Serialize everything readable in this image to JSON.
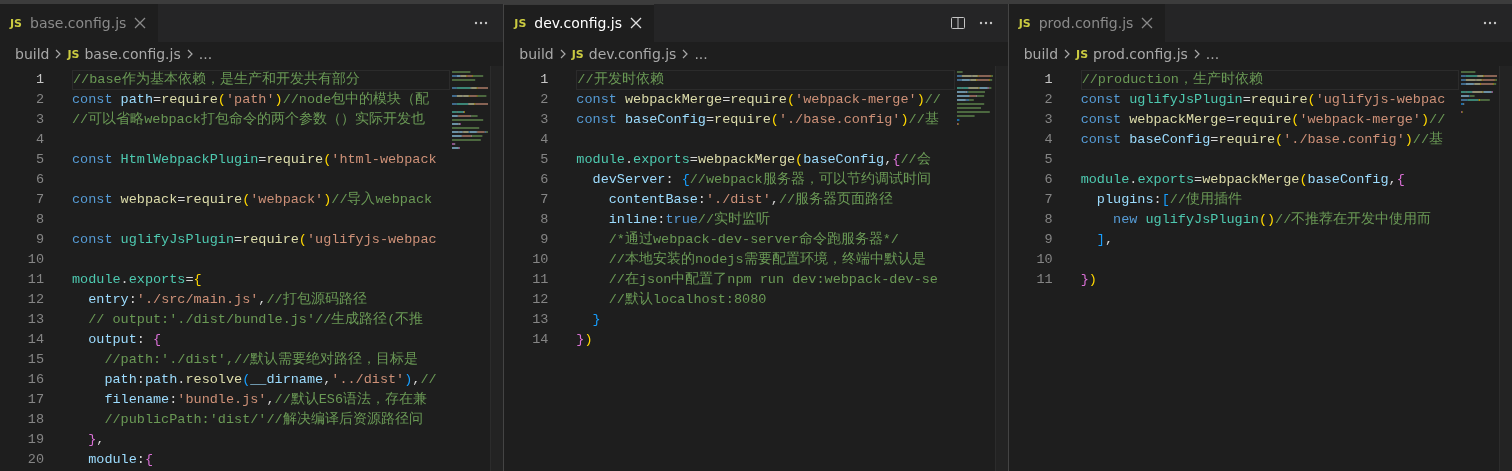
{
  "panes": [
    {
      "focused": false,
      "show_split": false,
      "tab": {
        "icon_text": "JS",
        "label": "base.config.js"
      },
      "breadcrumb": {
        "folder": "build",
        "icon_text": "JS",
        "file": "base.config.js",
        "tail": "..."
      },
      "lines": [
        {
          "number": "1",
          "current": true,
          "tokens": [
            {
              "kind": "cmt",
              "text": "//base作为基本依赖，是生产和开发共有部分"
            }
          ]
        },
        {
          "number": "2",
          "current": false,
          "tokens": [
            {
              "kind": "kw",
              "text": "const "
            },
            {
              "kind": "var",
              "text": "path"
            },
            {
              "kind": "plain",
              "text": "="
            },
            {
              "kind": "fn",
              "text": "require"
            },
            {
              "kind": "b1",
              "text": "("
            },
            {
              "kind": "str",
              "text": "'path'"
            },
            {
              "kind": "b1",
              "text": ")"
            },
            {
              "kind": "cmt",
              "text": "//node包中的模块（配"
            }
          ]
        },
        {
          "number": "3",
          "current": false,
          "tokens": [
            {
              "kind": "cmt",
              "text": "//可以省略webpack打包命令的两个参数（）实际开发也"
            }
          ]
        },
        {
          "number": "4",
          "current": false
        },
        {
          "number": "5",
          "current": false,
          "tokens": [
            {
              "kind": "kw",
              "text": "const "
            },
            {
              "kind": "type",
              "text": "HtmlWebpackPlugin"
            },
            {
              "kind": "plain",
              "text": "="
            },
            {
              "kind": "fn",
              "text": "require"
            },
            {
              "kind": "b1",
              "text": "("
            },
            {
              "kind": "str",
              "text": "'html-webpack"
            }
          ]
        },
        {
          "number": "6",
          "current": false
        },
        {
          "number": "7",
          "current": false,
          "tokens": [
            {
              "kind": "kw",
              "text": "const "
            },
            {
              "kind": "fn",
              "text": "webpack"
            },
            {
              "kind": "plain",
              "text": "="
            },
            {
              "kind": "fn",
              "text": "require"
            },
            {
              "kind": "b1",
              "text": "("
            },
            {
              "kind": "str",
              "text": "'webpack'"
            },
            {
              "kind": "b1",
              "text": ")"
            },
            {
              "kind": "cmt",
              "text": "//导入webpack"
            }
          ]
        },
        {
          "number": "8",
          "current": false
        },
        {
          "number": "9",
          "current": false,
          "tokens": [
            {
              "kind": "kw",
              "text": "const "
            },
            {
              "kind": "type",
              "text": "uglifyJsPlugin"
            },
            {
              "kind": "plain",
              "text": "="
            },
            {
              "kind": "fn",
              "text": "require"
            },
            {
              "kind": "b1",
              "text": "("
            },
            {
              "kind": "str",
              "text": "'uglifyjs-webpac"
            }
          ]
        },
        {
          "number": "10",
          "current": false
        },
        {
          "number": "11",
          "current": false,
          "tokens": [
            {
              "kind": "type",
              "text": "module"
            },
            {
              "kind": "plain",
              "text": "."
            },
            {
              "kind": "type",
              "text": "exports"
            },
            {
              "kind": "plain",
              "text": "="
            },
            {
              "kind": "b1",
              "text": "{"
            }
          ]
        },
        {
          "number": "12",
          "current": false,
          "tokens": [
            {
              "kind": "var",
              "text": "  entry"
            },
            {
              "kind": "plain",
              "text": ":"
            },
            {
              "kind": "str",
              "text": "'./src/main.js'"
            },
            {
              "kind": "plain",
              "text": ","
            },
            {
              "kind": "cmt",
              "text": "//打包源码路径"
            }
          ]
        },
        {
          "number": "13",
          "current": false,
          "tokens": [
            {
              "kind": "cmt",
              "text": "  // output:'./dist/bundle.js'//生成路径(不推"
            }
          ]
        },
        {
          "number": "14",
          "current": false,
          "tokens": [
            {
              "kind": "var",
              "text": "  output"
            },
            {
              "kind": "plain",
              "text": ": "
            },
            {
              "kind": "b2",
              "text": "{"
            }
          ]
        },
        {
          "number": "15",
          "current": false,
          "tokens": [
            {
              "kind": "cmt",
              "text": "    //path:'./dist',//默认需要绝对路径，目标是"
            }
          ]
        },
        {
          "number": "16",
          "current": false,
          "tokens": [
            {
              "kind": "var",
              "text": "    path"
            },
            {
              "kind": "plain",
              "text": ":"
            },
            {
              "kind": "var",
              "text": "path"
            },
            {
              "kind": "plain",
              "text": "."
            },
            {
              "kind": "fn",
              "text": "resolve"
            },
            {
              "kind": "b3",
              "text": "("
            },
            {
              "kind": "var",
              "text": "__dirname"
            },
            {
              "kind": "plain",
              "text": ","
            },
            {
              "kind": "str",
              "text": "'../dist'"
            },
            {
              "kind": "b3",
              "text": ")"
            },
            {
              "kind": "plain",
              "text": ","
            },
            {
              "kind": "cmt",
              "text": "//"
            }
          ]
        },
        {
          "number": "17",
          "current": false,
          "tokens": [
            {
              "kind": "var",
              "text": "    filename"
            },
            {
              "kind": "plain",
              "text": ":"
            },
            {
              "kind": "str",
              "text": "'bundle.js'"
            },
            {
              "kind": "plain",
              "text": ","
            },
            {
              "kind": "cmt",
              "text": "//默认ES6语法，存在兼"
            }
          ]
        },
        {
          "number": "18",
          "current": false,
          "tokens": [
            {
              "kind": "cmt",
              "text": "    //publicPath:'dist/'//解决编译后资源路径问"
            }
          ]
        },
        {
          "number": "19",
          "current": false,
          "tokens": [
            {
              "kind": "b2",
              "text": "  }"
            },
            {
              "kind": "plain",
              "text": ","
            }
          ]
        },
        {
          "number": "20",
          "current": false,
          "tokens": [
            {
              "kind": "var",
              "text": "  module"
            },
            {
              "kind": "plain",
              "text": ":"
            },
            {
              "kind": "b2",
              "text": "{"
            }
          ]
        }
      ]
    },
    {
      "focused": true,
      "show_split": true,
      "tab": {
        "icon_text": "JS",
        "label": "dev.config.js"
      },
      "breadcrumb": {
        "folder": "build",
        "icon_text": "JS",
        "file": "dev.config.js",
        "tail": "..."
      },
      "lines": [
        {
          "number": "1",
          "current": true,
          "tokens": [
            {
              "kind": "cmt",
              "text": "//开发时依赖"
            }
          ]
        },
        {
          "number": "2",
          "current": false,
          "tokens": [
            {
              "kind": "kw",
              "text": "const "
            },
            {
              "kind": "fn",
              "text": "webpackMerge"
            },
            {
              "kind": "plain",
              "text": "="
            },
            {
              "kind": "fn",
              "text": "require"
            },
            {
              "kind": "b1",
              "text": "("
            },
            {
              "kind": "str",
              "text": "'webpack-merge'"
            },
            {
              "kind": "b1",
              "text": ")"
            },
            {
              "kind": "cmt",
              "text": "//"
            }
          ]
        },
        {
          "number": "3",
          "current": false,
          "tokens": [
            {
              "kind": "kw",
              "text": "const "
            },
            {
              "kind": "var",
              "text": "baseConfig"
            },
            {
              "kind": "plain",
              "text": "="
            },
            {
              "kind": "fn",
              "text": "require"
            },
            {
              "kind": "b1",
              "text": "("
            },
            {
              "kind": "str",
              "text": "'./base.config'"
            },
            {
              "kind": "b1",
              "text": ")"
            },
            {
              "kind": "cmt",
              "text": "//基"
            }
          ]
        },
        {
          "number": "4",
          "current": false
        },
        {
          "number": "5",
          "current": false,
          "tokens": [
            {
              "kind": "type",
              "text": "module"
            },
            {
              "kind": "plain",
              "text": "."
            },
            {
              "kind": "type",
              "text": "exports"
            },
            {
              "kind": "plain",
              "text": "="
            },
            {
              "kind": "fn",
              "text": "webpackMerge"
            },
            {
              "kind": "b1",
              "text": "("
            },
            {
              "kind": "var",
              "text": "baseConfig"
            },
            {
              "kind": "plain",
              "text": ","
            },
            {
              "kind": "b2",
              "text": "{"
            },
            {
              "kind": "cmt",
              "text": "//会"
            }
          ]
        },
        {
          "number": "6",
          "current": false,
          "tokens": [
            {
              "kind": "var",
              "text": "  devServer"
            },
            {
              "kind": "plain",
              "text": ": "
            },
            {
              "kind": "b3",
              "text": "{"
            },
            {
              "kind": "cmt",
              "text": "//webpack服务器，可以节约调试时间"
            }
          ]
        },
        {
          "number": "7",
          "current": false,
          "tokens": [
            {
              "kind": "var",
              "text": "    contentBase"
            },
            {
              "kind": "plain",
              "text": ":"
            },
            {
              "kind": "str",
              "text": "'./dist'"
            },
            {
              "kind": "plain",
              "text": ","
            },
            {
              "kind": "cmt",
              "text": "//服务器页面路径"
            }
          ]
        },
        {
          "number": "8",
          "current": false,
          "tokens": [
            {
              "kind": "var",
              "text": "    inline"
            },
            {
              "kind": "plain",
              "text": ":"
            },
            {
              "kind": "kw",
              "text": "true"
            },
            {
              "kind": "cmt",
              "text": "//实时监听"
            }
          ]
        },
        {
          "number": "9",
          "current": false,
          "tokens": [
            {
              "kind": "cmt",
              "text": "    /*通过webpack-dev-server命令跑服务器*/"
            }
          ]
        },
        {
          "number": "10",
          "current": false,
          "tokens": [
            {
              "kind": "cmt",
              "text": "    //本地安装的nodejs需要配置环境，终端中默认是"
            }
          ]
        },
        {
          "number": "11",
          "current": false,
          "tokens": [
            {
              "kind": "cmt",
              "text": "    //在json中配置了npm run dev:webpack-dev-se"
            }
          ]
        },
        {
          "number": "12",
          "current": false,
          "tokens": [
            {
              "kind": "cmt",
              "text": "    //默认localhost:8080"
            }
          ]
        },
        {
          "number": "13",
          "current": false,
          "tokens": [
            {
              "kind": "b3",
              "text": "  }"
            }
          ]
        },
        {
          "number": "14",
          "current": false,
          "tokens": [
            {
              "kind": "b2",
              "text": "}"
            },
            {
              "kind": "b1",
              "text": ")"
            }
          ]
        }
      ]
    },
    {
      "focused": false,
      "show_split": false,
      "tab": {
        "icon_text": "JS",
        "label": "prod.config.js"
      },
      "breadcrumb": {
        "folder": "build",
        "icon_text": "JS",
        "file": "prod.config.js",
        "tail": "..."
      },
      "lines": [
        {
          "number": "1",
          "current": true,
          "tokens": [
            {
              "kind": "cmt",
              "text": "//production，生产时依赖"
            }
          ]
        },
        {
          "number": "2",
          "current": false,
          "tokens": [
            {
              "kind": "kw",
              "text": "const "
            },
            {
              "kind": "type",
              "text": "uglifyJsPlugin"
            },
            {
              "kind": "plain",
              "text": "="
            },
            {
              "kind": "fn",
              "text": "require"
            },
            {
              "kind": "b1",
              "text": "("
            },
            {
              "kind": "str",
              "text": "'uglifyjs-webpac"
            }
          ]
        },
        {
          "number": "3",
          "current": false,
          "tokens": [
            {
              "kind": "kw",
              "text": "const "
            },
            {
              "kind": "fn",
              "text": "webpackMerge"
            },
            {
              "kind": "plain",
              "text": "="
            },
            {
              "kind": "fn",
              "text": "require"
            },
            {
              "kind": "b1",
              "text": "("
            },
            {
              "kind": "str",
              "text": "'webpack-merge'"
            },
            {
              "kind": "b1",
              "text": ")"
            },
            {
              "kind": "cmt",
              "text": "//"
            }
          ]
        },
        {
          "number": "4",
          "current": false,
          "tokens": [
            {
              "kind": "kw",
              "text": "const "
            },
            {
              "kind": "var",
              "text": "baseConfig"
            },
            {
              "kind": "plain",
              "text": "="
            },
            {
              "kind": "fn",
              "text": "require"
            },
            {
              "kind": "b1",
              "text": "("
            },
            {
              "kind": "str",
              "text": "'./base.config'"
            },
            {
              "kind": "b1",
              "text": ")"
            },
            {
              "kind": "cmt",
              "text": "//基"
            }
          ]
        },
        {
          "number": "5",
          "current": false
        },
        {
          "number": "6",
          "current": false,
          "tokens": [
            {
              "kind": "type",
              "text": "module"
            },
            {
              "kind": "plain",
              "text": "."
            },
            {
              "kind": "type",
              "text": "exports"
            },
            {
              "kind": "plain",
              "text": "="
            },
            {
              "kind": "fn",
              "text": "webpackMerge"
            },
            {
              "kind": "b1",
              "text": "("
            },
            {
              "kind": "var",
              "text": "baseConfig"
            },
            {
              "kind": "plain",
              "text": ","
            },
            {
              "kind": "b2",
              "text": "{"
            }
          ]
        },
        {
          "number": "7",
          "current": false,
          "tokens": [
            {
              "kind": "var",
              "text": "  plugins"
            },
            {
              "kind": "plain",
              "text": ":"
            },
            {
              "kind": "b3",
              "text": "["
            },
            {
              "kind": "cmt",
              "text": "//使用插件"
            }
          ]
        },
        {
          "number": "8",
          "current": false,
          "tokens": [
            {
              "kind": "kw",
              "text": "    new "
            },
            {
              "kind": "type",
              "text": "uglifyJsPlugin"
            },
            {
              "kind": "b1",
              "text": "()"
            },
            {
              "kind": "cmt",
              "text": "//不推荐在开发中使用而"
            }
          ]
        },
        {
          "number": "9",
          "current": false,
          "tokens": [
            {
              "kind": "b3",
              "text": "  ]"
            },
            {
              "kind": "plain",
              "text": ","
            }
          ]
        },
        {
          "number": "10",
          "current": false
        },
        {
          "number": "11",
          "current": false,
          "tokens": [
            {
              "kind": "b2",
              "text": "}"
            },
            {
              "kind": "b1",
              "text": ")"
            }
          ]
        }
      ]
    }
  ]
}
